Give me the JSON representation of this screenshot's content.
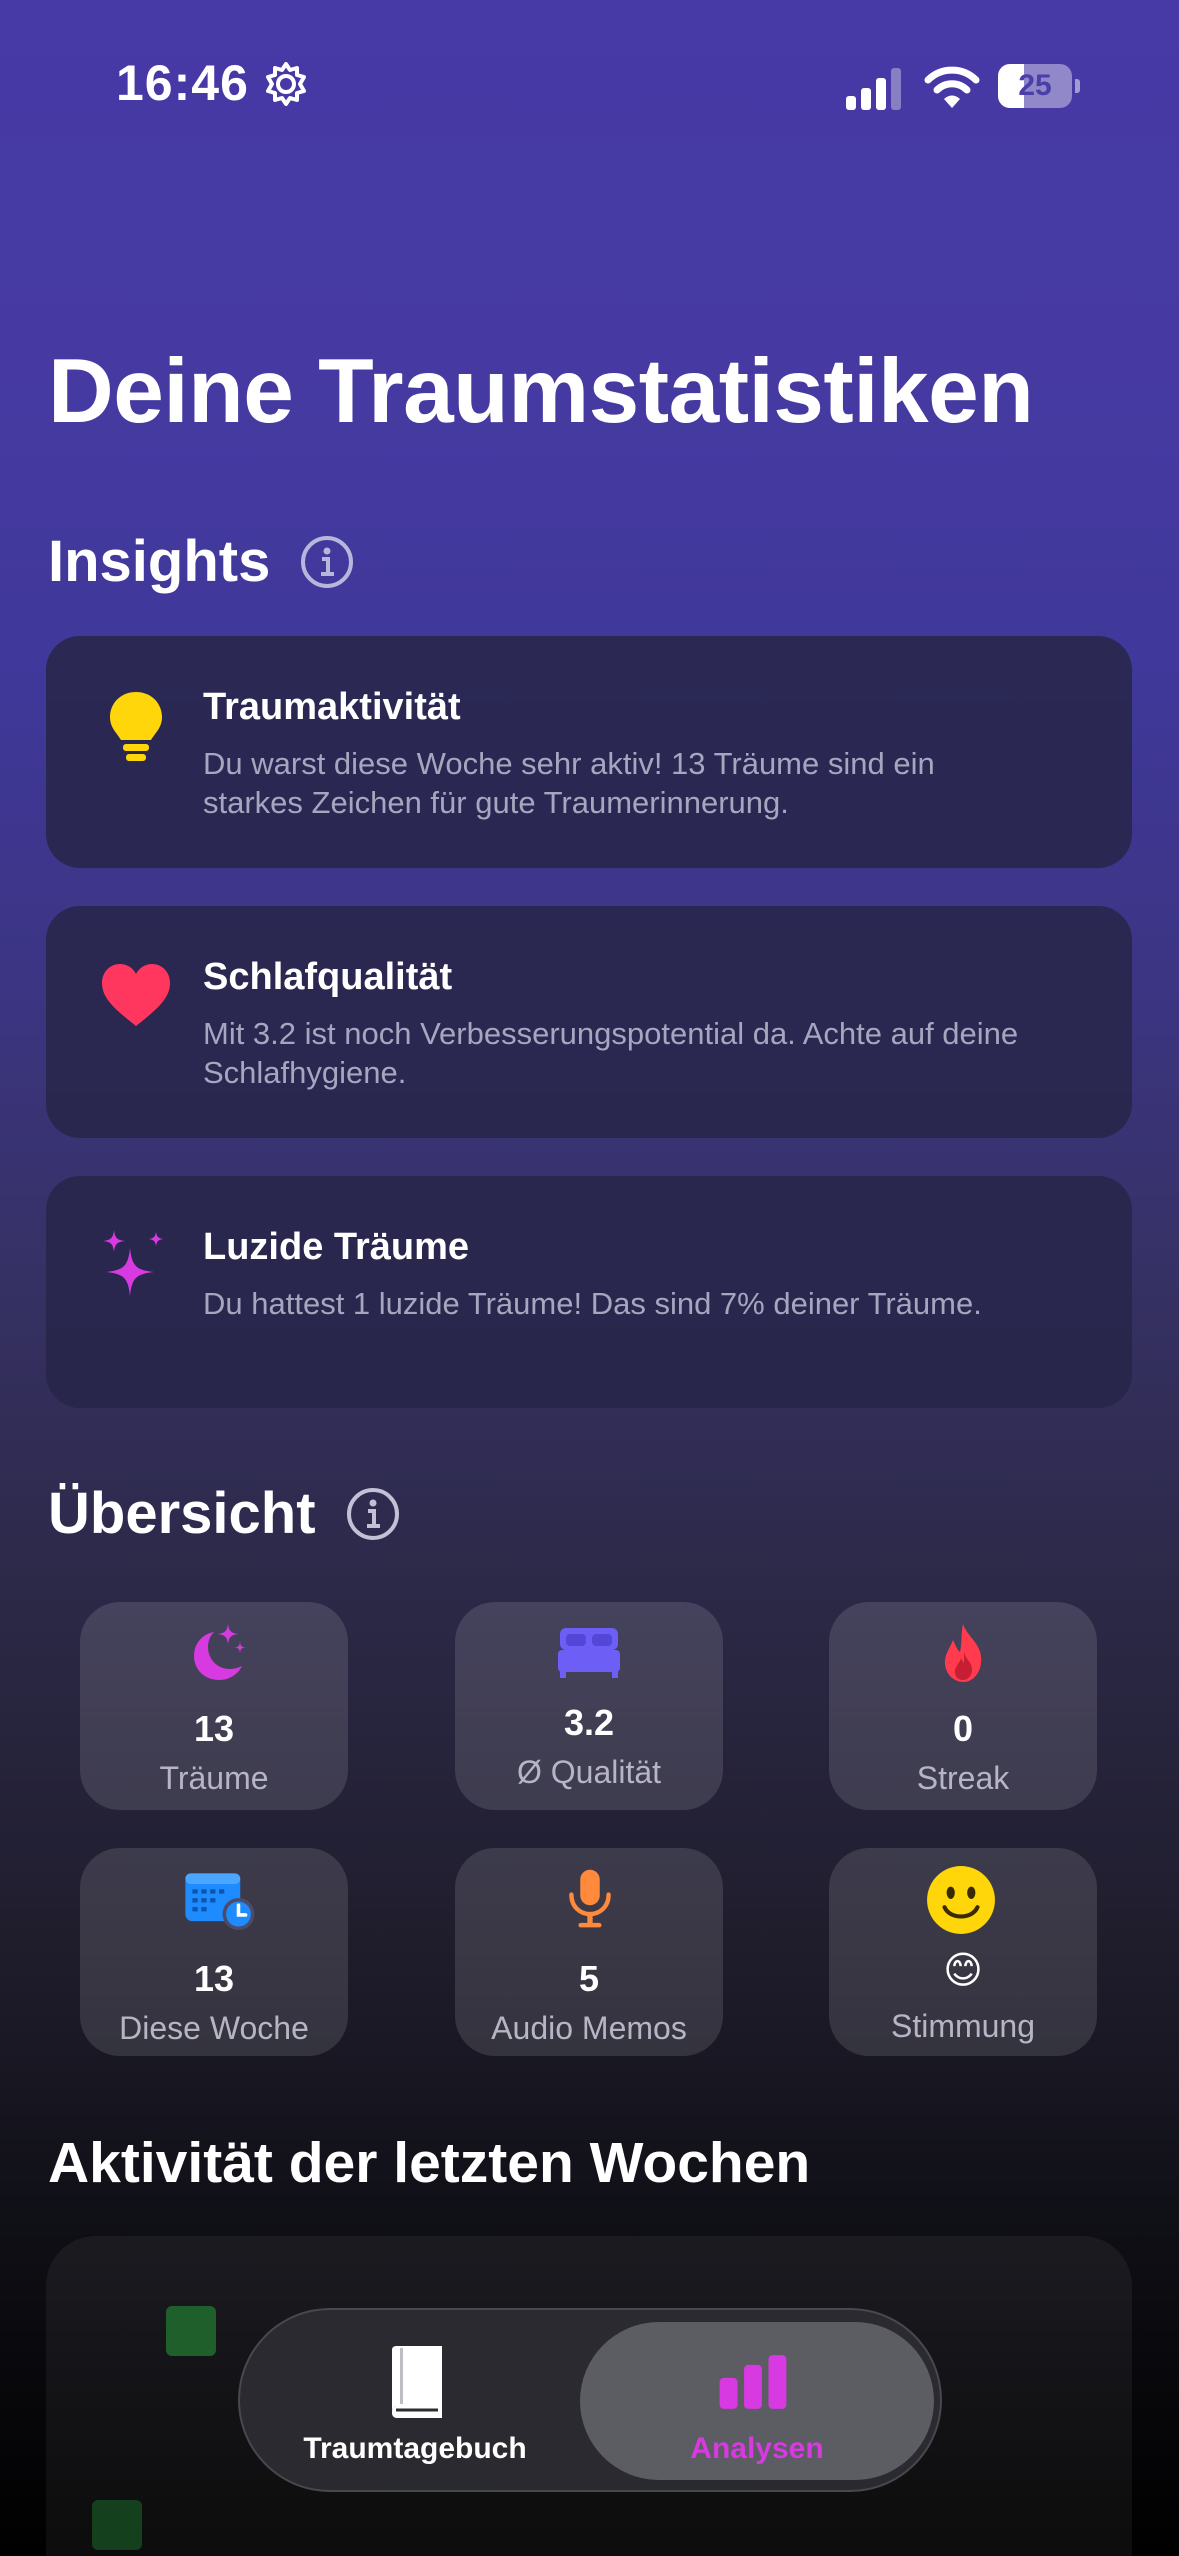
{
  "status_bar": {
    "time": "16:46",
    "battery_level": "25",
    "icons": [
      "gear-icon",
      "signal-icon",
      "wifi-icon",
      "battery-icon"
    ]
  },
  "page": {
    "title": "Deine Traumstatistiken"
  },
  "insights": {
    "title": "Insights",
    "items": [
      {
        "icon": "lightbulb-icon",
        "title": "Traumaktivität",
        "description": "Du warst diese Woche sehr aktiv! 13 Träume sind ein starkes Zeichen für gute Traumerinnerung."
      },
      {
        "icon": "heart-icon",
        "title": "Schlafqualität",
        "description": "Mit 3.2 ist noch Verbesserungspotential da. Achte auf deine Schlafhygiene."
      },
      {
        "icon": "sparkles-icon",
        "title": "Luzide Träume",
        "description": "Du hattest 1 luzide Träume! Das sind 7% deiner Träume."
      }
    ]
  },
  "overview": {
    "title": "Übersicht",
    "tiles": [
      {
        "icon": "moon-stars-icon",
        "value": "13",
        "label": "Träume"
      },
      {
        "icon": "bed-icon",
        "value": "3.2",
        "label": "Ø Qualität"
      },
      {
        "icon": "flame-icon",
        "value": "0",
        "label": "Streak"
      },
      {
        "icon": "calendar-clock-icon",
        "value": "13",
        "label": "Diese Woche"
      },
      {
        "icon": "microphone-icon",
        "value": "5",
        "label": "Audio Memos"
      },
      {
        "icon": "smiley-icon",
        "value": "😊",
        "label": "Stimmung"
      }
    ]
  },
  "activity": {
    "title": "Aktivität der letzten Wochen"
  },
  "tab_bar": {
    "tabs": [
      {
        "icon": "book-icon",
        "label": "Traumtagebuch",
        "active": false
      },
      {
        "icon": "chart-bar-icon",
        "label": "Analysen",
        "active": true
      }
    ]
  },
  "colors": {
    "accent_active_tab": "#d63ae0",
    "background_top": "#4739a6",
    "card_background": "#28264a",
    "secondary_text": "#a7a6bf"
  }
}
